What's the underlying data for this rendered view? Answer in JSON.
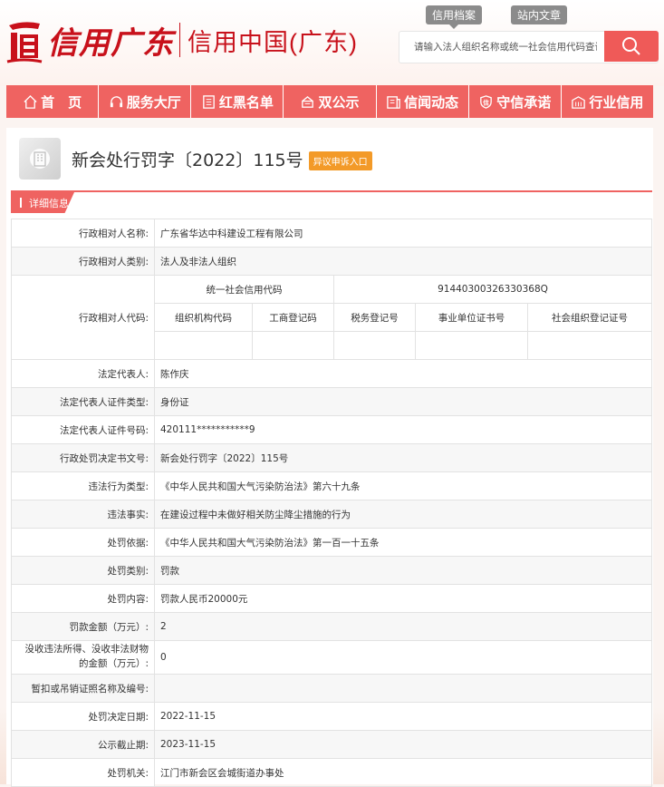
{
  "header": {
    "logo_script": "信用广东",
    "logo_title": "信用中国(广东)",
    "top_tabs": [
      {
        "label": "信用档案"
      },
      {
        "label": "站内文章"
      }
    ],
    "search_placeholder": "请输入法人组织名称或统一社会信用代码查询"
  },
  "nav": [
    {
      "label": "首　页",
      "icon": "home-icon"
    },
    {
      "label": "服务大厅",
      "icon": "headset-icon"
    },
    {
      "label": "红黑名单",
      "icon": "list-icon"
    },
    {
      "label": "双公示",
      "icon": "announce-icon"
    },
    {
      "label": "信闻动态",
      "icon": "news-icon"
    },
    {
      "label": "守信承诺",
      "icon": "pledge-icon"
    },
    {
      "label": "行业信用",
      "icon": "industry-icon"
    }
  ],
  "doc": {
    "title": "新会处行罚字〔2022〕115号",
    "appeal_badge": "异议申诉入口",
    "section_tab": "详细信息"
  },
  "detail": {
    "party_name_label": "行政相对人名称:",
    "party_name": "广东省华达中科建设工程有限公司",
    "party_type_label": "行政相对人类别:",
    "party_type": "法人及非法人组织",
    "party_code_label": "行政相对人代码:",
    "uscc_label": "统一社会信用代码",
    "uscc_value": "91440300326330368Q",
    "code_headers": [
      "组织机构代码",
      "工商登记码",
      "税务登记号",
      "事业单位证书号",
      "社会组织登记证号"
    ],
    "rows": [
      {
        "label": "法定代表人:",
        "value": "陈作庆"
      },
      {
        "label": "法定代表人证件类型:",
        "value": "身份证"
      },
      {
        "label": "法定代表人证件号码:",
        "value": "420111***********9"
      },
      {
        "label": "行政处罚决定书文号:",
        "value": "新会处行罚字〔2022〕115号"
      },
      {
        "label": "违法行为类型:",
        "value": "《中华人民共和国大气污染防治法》第六十九条"
      },
      {
        "label": "违法事实:",
        "value": "在建设过程中未做好相关防尘降尘措施的行为"
      },
      {
        "label": "处罚依据:",
        "value": "《中华人民共和国大气污染防治法》第一百一十五条"
      },
      {
        "label": "处罚类别:",
        "value": "罚款"
      },
      {
        "label": "处罚内容:",
        "value": "罚款人民币20000元"
      },
      {
        "label": "罚款金额（万元）:",
        "value": "2"
      },
      {
        "label": "没收违法所得、没收非法财物的金额（万元）:",
        "value": "0"
      },
      {
        "label": "暂扣或吊销证照名称及编号:",
        "value": ""
      },
      {
        "label": "处罚决定日期:",
        "value": "2022-11-15"
      },
      {
        "label": "公示截止期:",
        "value": "2023-11-15"
      },
      {
        "label": "处罚机关:",
        "value": "江门市新会区会城街道办事处"
      }
    ]
  },
  "colors": {
    "brand_red": "#c8111b",
    "nav_red": "#ef6361",
    "badge_orange": "#f39a28"
  }
}
